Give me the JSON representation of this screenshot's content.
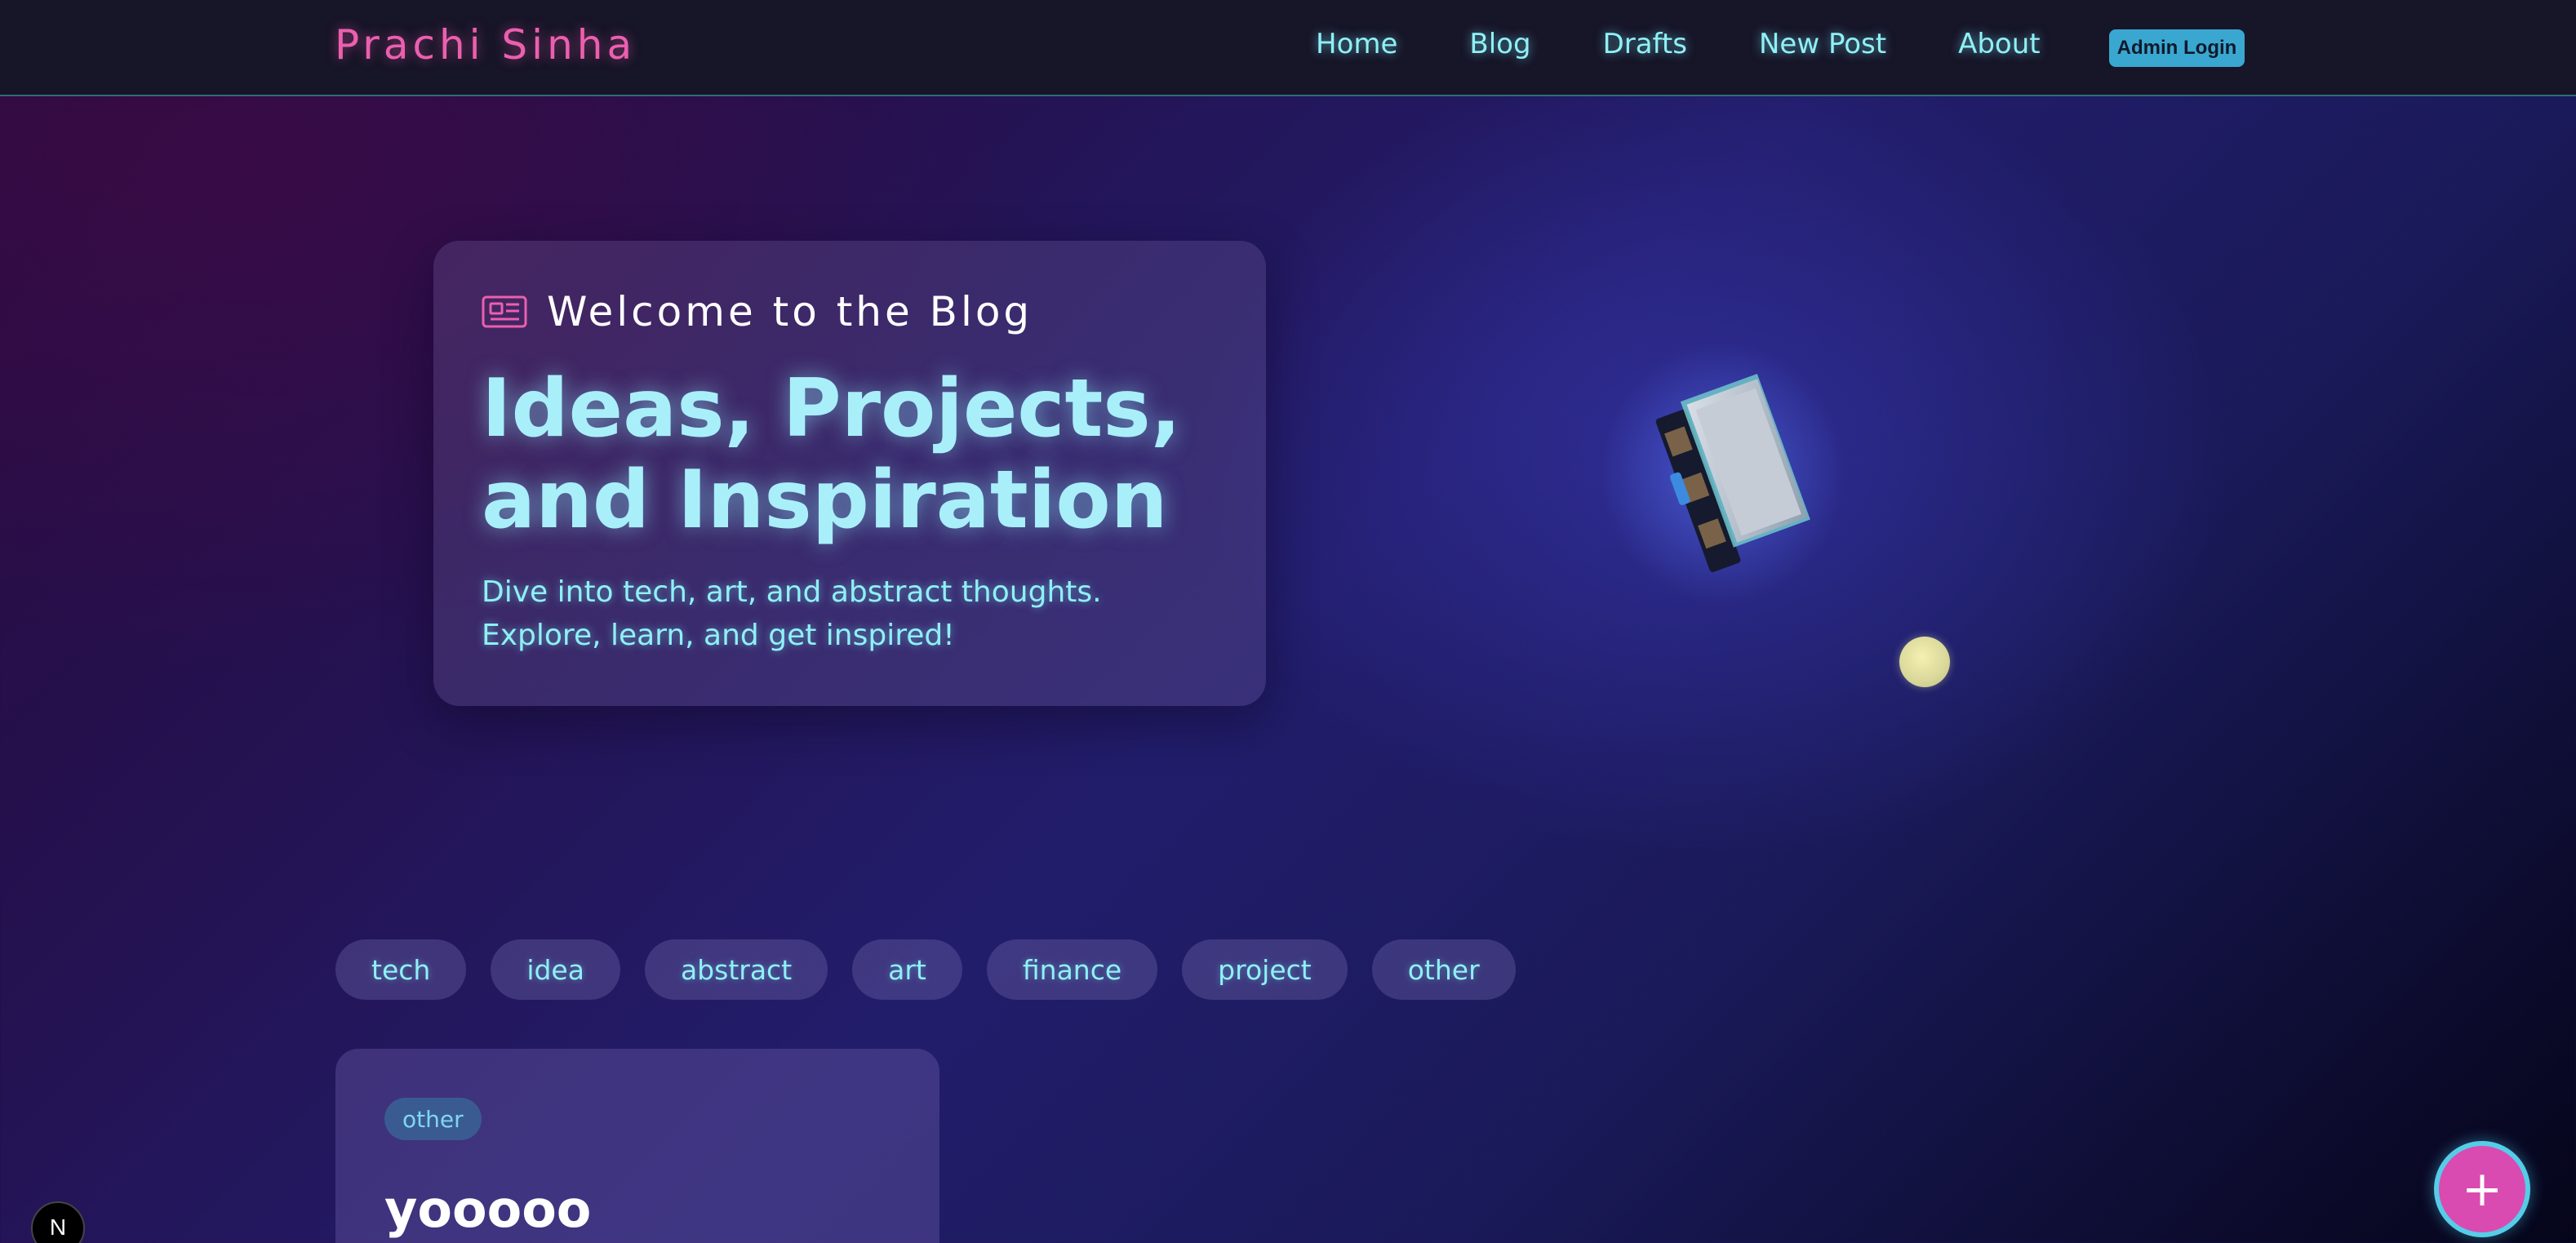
{
  "navbar": {
    "brand": "Prachi Sinha",
    "links": [
      "Home",
      "Blog",
      "Drafts",
      "New Post",
      "About"
    ],
    "admin_label": "Admin Login"
  },
  "hero": {
    "eyebrow_icon": "newspaper-icon",
    "eyebrow": "Welcome to the Blog",
    "title": "Ideas, Projects, and Inspiration",
    "subtitle": "Dive into tech, art, and abstract thoughts. Explore, learn, and get inspired!"
  },
  "tags": [
    "tech",
    "idea",
    "abstract",
    "art",
    "finance",
    "project",
    "other"
  ],
  "posts": [
    {
      "category": "other",
      "title": "yooooo"
    }
  ],
  "fab": {
    "label": "+"
  },
  "next_indicator": {
    "label": "N"
  },
  "colors": {
    "brand": "#ec5fae",
    "accent": "#8ff0f5",
    "admin_button": "#3aa7d1",
    "fab": "#d94bb0"
  }
}
